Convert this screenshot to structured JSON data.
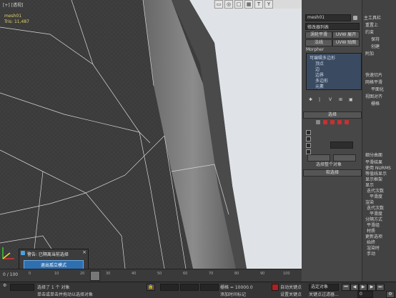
{
  "viewport": {
    "label": "[+] [透视]",
    "stats": [
      "Polys: ...",
      "Tris: ..."
    ],
    "stats_visible": [
      "mesh01",
      "Tris: 11,487"
    ]
  },
  "toolbar": {
    "icons": [
      "min-icon",
      "target-icon",
      "square-icon",
      "grid-icon",
      "text-icon",
      "tool-icon"
    ]
  },
  "popup": {
    "title": "警告: 已隔离当前选择",
    "button_label": "退出孤立模式"
  },
  "panel": {
    "object_name": "mesh01",
    "modifier_list": "修改器列表",
    "btn_smooth": "涡轮平滑",
    "btn_smooth_right": "UVW 展开",
    "btn_normal": "法线",
    "btn_normal_right": "UVW 贴图",
    "section_morpher": "Morpher",
    "stack_items": [
      "可编辑多边形",
      "顶点",
      "边",
      "边界",
      "多边形",
      "元素"
    ],
    "rollout_select": "选择",
    "text_select_all": "选择整个对象",
    "rollout_soft": "软选择"
  },
  "panel_right": {
    "title": "主工具栏",
    "labels": [
      "重置上",
      "约束",
      "保持",
      "创建",
      "附加",
      "快速切片",
      "网格平滑",
      "平面化",
      "视图对齐",
      "栅格",
      "细分曲面",
      "平滑结果",
      "使用 NURMS",
      "等值线显示",
      "显示框架",
      "显示",
      "迭代次数",
      "平滑度",
      "渲染",
      "迭代次数",
      "平滑度",
      "分隔方式",
      "平滑组",
      "材质",
      "更新选项",
      "始终",
      "渲染时",
      "手动"
    ]
  },
  "timeline": {
    "frame_label": "0 / 100",
    "ticks": [
      "0",
      "10",
      "20",
      "30",
      "40",
      "50",
      "60",
      "70",
      "80",
      "90",
      "100"
    ]
  },
  "statusbar": {
    "selected": "选择了 1 个 对象",
    "hint": "单击或单击并拖动以选择对象",
    "grid": "栅格 = 10000.0",
    "add_time_tag": "添加时间标记",
    "auto_key": "自动关键点",
    "set_key": "设置关键点",
    "selected_obj": "选定对象",
    "key_filters": "关键点过滤器...",
    "frame": "0"
  }
}
